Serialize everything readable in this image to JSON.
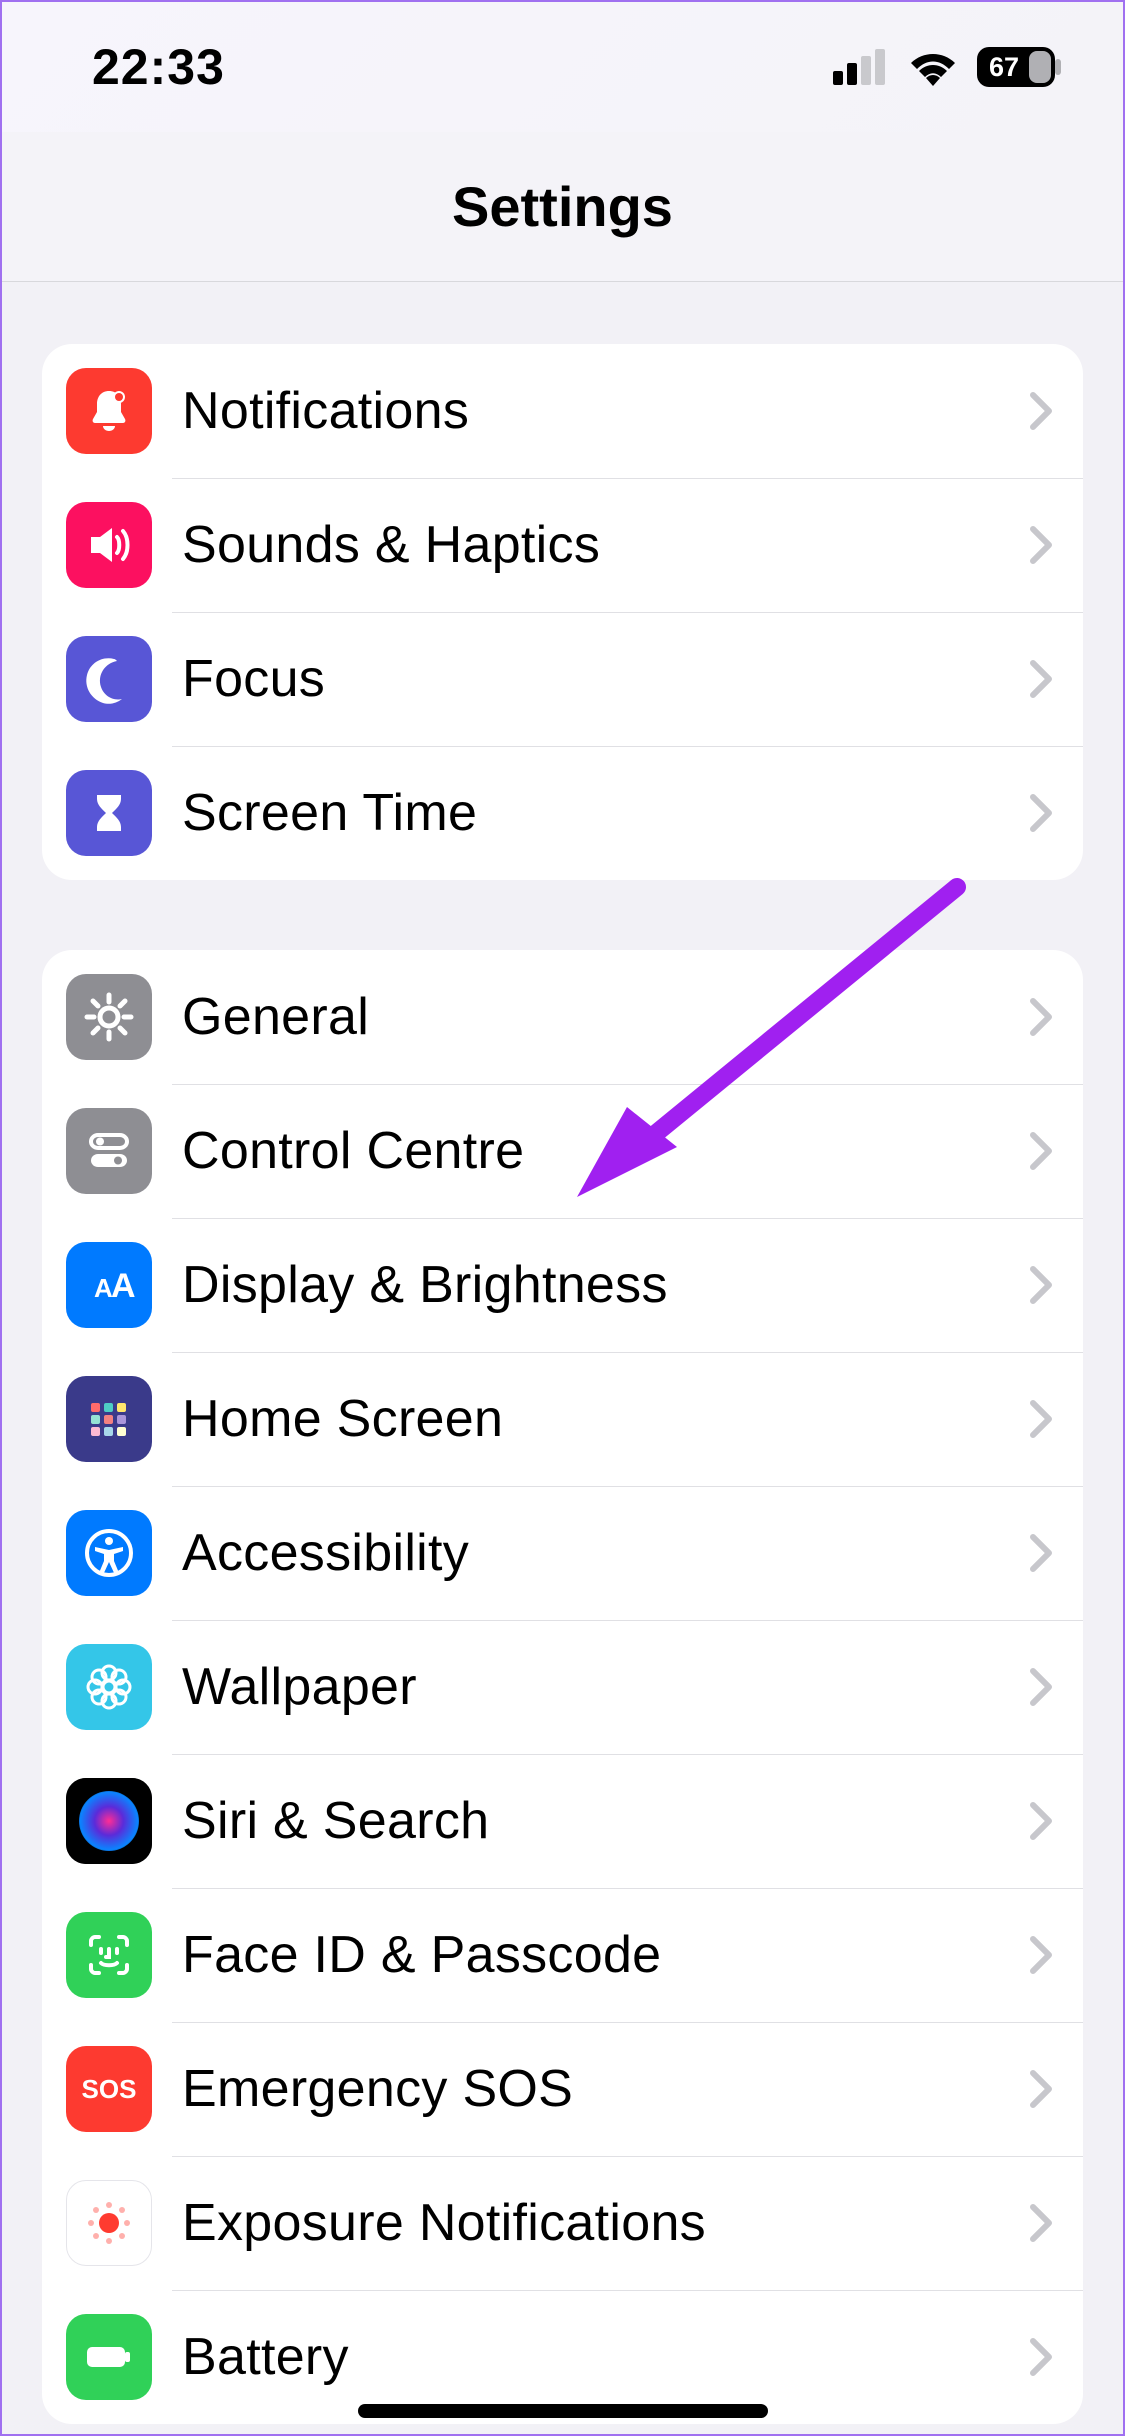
{
  "status": {
    "time": "22:33",
    "battery": "67"
  },
  "header": {
    "title": "Settings"
  },
  "groups": {
    "g1": {
      "notifications": "Notifications",
      "sounds": "Sounds & Haptics",
      "focus": "Focus",
      "screentime": "Screen Time"
    },
    "g2": {
      "general": "General",
      "control": "Control Centre",
      "display": "Display & Brightness",
      "home": "Home Screen",
      "accessibility": "Accessibility",
      "wallpaper": "Wallpaper",
      "siri": "Siri & Search",
      "faceid": "Face ID & Passcode",
      "sos": "Emergency SOS",
      "exposure": "Exposure Notifications",
      "battery": "Battery"
    }
  }
}
